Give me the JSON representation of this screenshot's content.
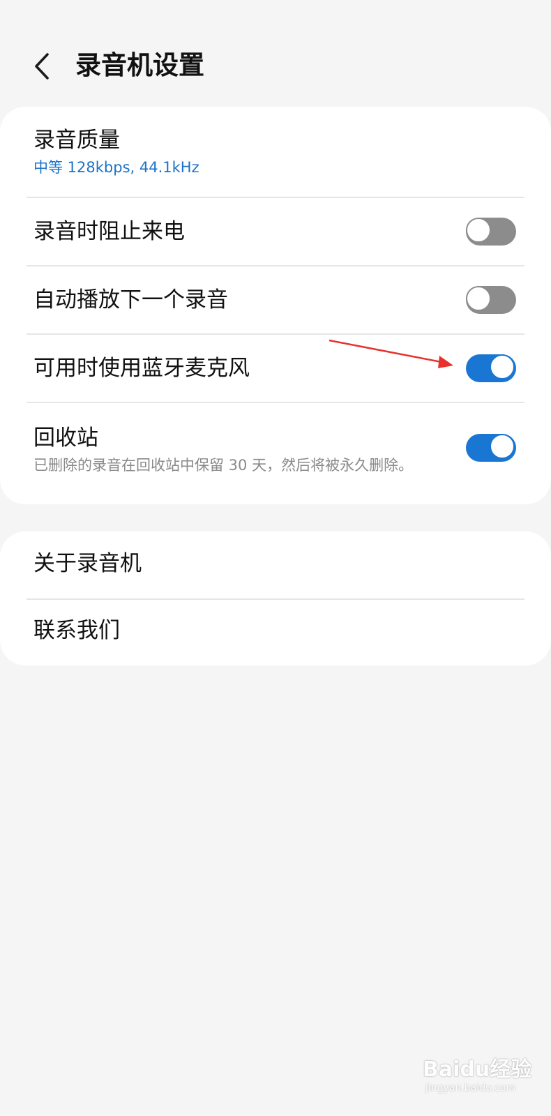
{
  "header": {
    "back_icon": "chevron-left-icon",
    "title": "录音机设置"
  },
  "settings": {
    "recording_quality": {
      "label": "录音质量",
      "value": "中等 128kbps, 44.1kHz"
    },
    "block_calls": {
      "label": "录音时阻止来电",
      "enabled": false
    },
    "autoplay_next": {
      "label": "自动播放下一个录音",
      "enabled": false
    },
    "bluetooth_mic": {
      "label": "可用时使用蓝牙麦克风",
      "enabled": true
    },
    "recycle_bin": {
      "label": "回收站",
      "description": "已删除的录音在回收站中保留 30 天，然后将被永久删除。",
      "enabled": true
    }
  },
  "about": {
    "about_label": "关于录音机",
    "contact_label": "联系我们"
  },
  "colors": {
    "accent": "#1a76d3",
    "link_blue": "#1a73c8",
    "toggle_off": "#8c8c8c",
    "annotation_arrow": "#e8312a",
    "background": "#f5f5f5",
    "card": "#ffffff"
  },
  "watermark": {
    "main": "Baidu经验",
    "sub": "jingyan.baidu.com"
  }
}
